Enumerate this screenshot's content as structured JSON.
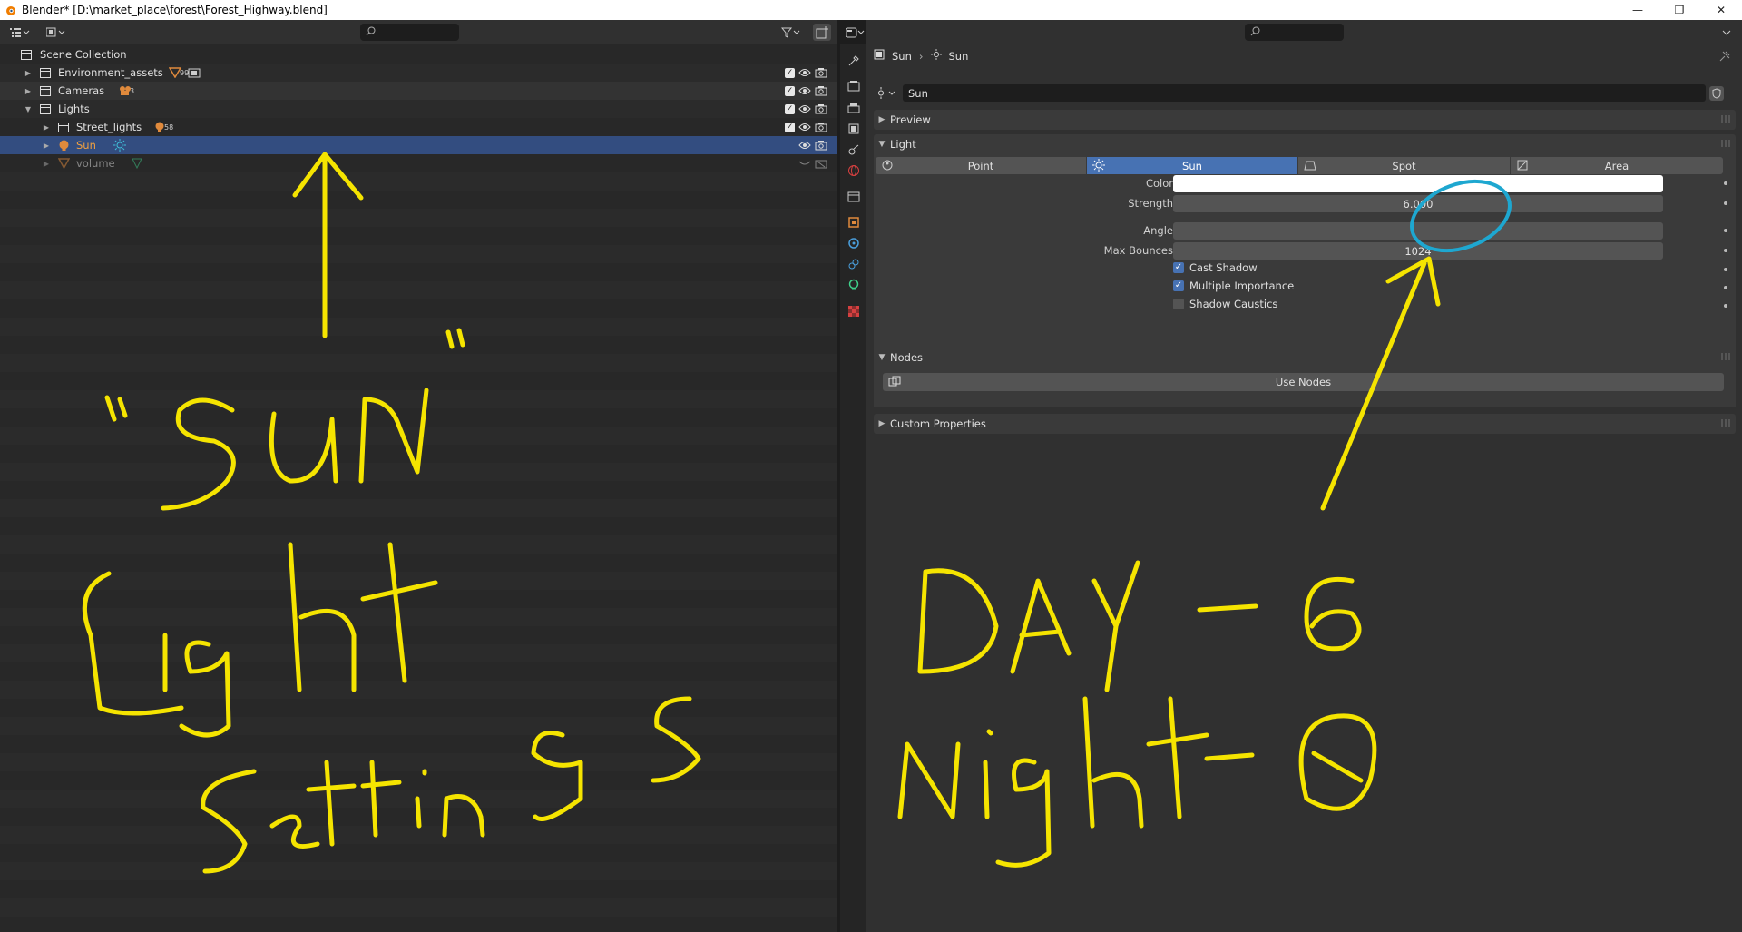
{
  "window": {
    "title": "Blender* [D:\\market_place\\forest\\Forest_Highway.blend]",
    "minimize": "—",
    "maximize": "❐",
    "close": "✕"
  },
  "outliner": {
    "items": [
      {
        "label": "Scene Collection",
        "badge": ""
      },
      {
        "label": "Environment_assets",
        "badge": "99"
      },
      {
        "label": "Cameras",
        "badge": "3"
      },
      {
        "label": "Lights",
        "badge": ""
      },
      {
        "label": "Street_lights",
        "badge": "58"
      },
      {
        "label": "Sun",
        "badge": ""
      },
      {
        "label": "volume",
        "badge": ""
      }
    ]
  },
  "properties": {
    "breadcrumb": {
      "object": "Sun",
      "data": "Sun"
    },
    "datablock_name": "Sun",
    "panels": {
      "preview": "Preview",
      "light": "Light",
      "nodes": "Nodes",
      "custom": "Custom Properties"
    },
    "light_types": [
      "Point",
      "Sun",
      "Spot",
      "Area"
    ],
    "active_type": "Sun",
    "fields": {
      "color_label": "Color",
      "color_value": "#ffffff",
      "strength_label": "Strength",
      "strength_value": "6.000",
      "angle_label": "Angle",
      "angle_value": "",
      "bounces_label": "Max Bounces",
      "bounces_value": "1024"
    },
    "checkboxes": {
      "cast_shadow": {
        "label": "Cast Shadow",
        "checked": true
      },
      "multiple_importance": {
        "label": "Multiple Importance",
        "checked": true
      },
      "shadow_caustics": {
        "label": "Shadow Caustics",
        "checked": false
      }
    },
    "use_nodes": "Use Nodes"
  },
  "colors": {
    "selection": "#334d80",
    "accent": "#4772b3",
    "annotation_yellow": "#f5e400",
    "annotation_cyan": "#1ea7d0"
  }
}
